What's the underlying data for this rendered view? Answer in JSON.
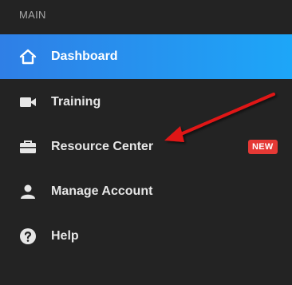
{
  "sidebar": {
    "section_label": "MAIN",
    "items": [
      {
        "label": "Dashboard",
        "icon": "home-icon",
        "active": true
      },
      {
        "label": "Training",
        "icon": "video-camera-icon"
      },
      {
        "label": "Resource Center",
        "icon": "briefcase-icon",
        "badge": "NEW"
      },
      {
        "label": "Manage Account",
        "icon": "user-icon"
      },
      {
        "label": "Help",
        "icon": "help-circle-icon"
      }
    ]
  },
  "colors": {
    "background": "#232323",
    "active_gradient_start": "#2f7fe6",
    "active_gradient_end": "#1da6f8",
    "badge": "#e53935",
    "annotation_arrow": "#e01919"
  }
}
